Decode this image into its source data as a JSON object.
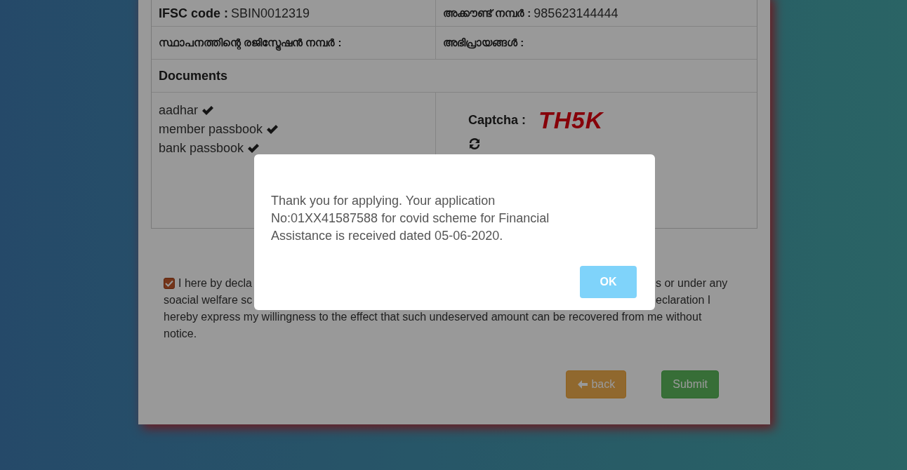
{
  "details": [
    {
      "label": "IFSC code :",
      "value": "SBIN0012319"
    },
    {
      "label": "അക്കൗണ്ട് നമ്പർ :",
      "value": "985623144444"
    },
    {
      "label": "സ്ഥാപനത്തിന്റെ രജിസ്ട്രേഷൻ നമ്പർ :"
    },
    {
      "label": "അഭിപ്രായങ്ങൾ :"
    }
  ],
  "documents": {
    "heading": "Documents",
    "items": [
      {
        "name": "aadhar",
        "verified": true
      },
      {
        "name": "member passbook",
        "verified": true
      },
      {
        "name": "bank passbook",
        "verified": true
      }
    ]
  },
  "captcha": {
    "label": "Captcha :",
    "code": "TH5K"
  },
  "declaration": {
    "checked": true,
    "lines": [
      {
        "left": "I here by decla",
        "right": "s or under any"
      },
      {
        "left": "soacial welfare sc",
        "right": "eclaration I"
      },
      {
        "left": "hereby express my willingness to the effect that such undeserved amount can be recovered from me without"
      },
      {
        "left": "notice."
      }
    ]
  },
  "buttons": {
    "back": "back",
    "submit": "Submit"
  },
  "dialog": {
    "message": "Thank you for applying. Your application No:01XX41587588 for covid scheme for Financial Assistance is received dated 05-06-2020.",
    "ok": "OK"
  }
}
